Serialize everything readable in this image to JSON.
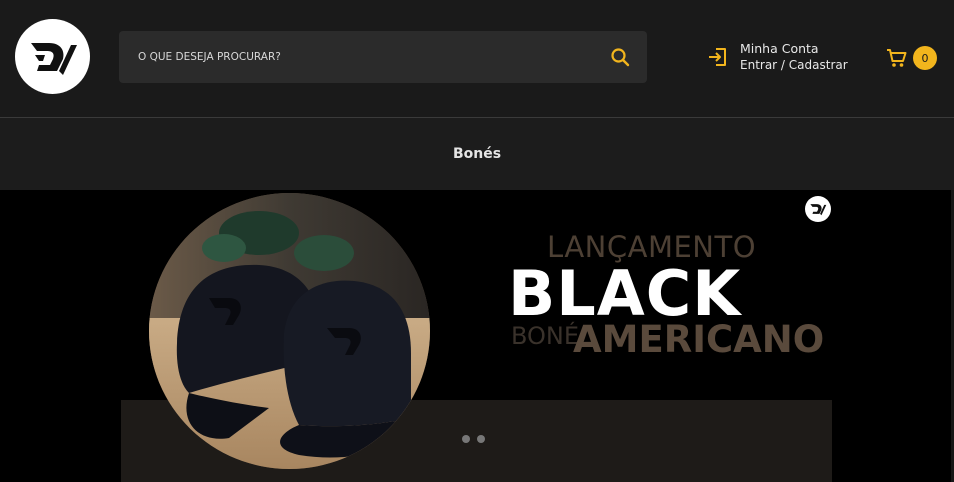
{
  "header": {
    "logo_icon": "dv-monogram-logo",
    "search": {
      "placeholder": "O QUE DESEJA PROCURAR?",
      "value": "",
      "icon": "search-icon"
    },
    "account": {
      "icon": "login-icon",
      "title": "Minha Conta",
      "subtitle": "Entrar / Cadastrar"
    },
    "cart": {
      "icon": "cart-icon",
      "count": "0"
    }
  },
  "nav": {
    "items": [
      {
        "label": "Bonés"
      }
    ]
  },
  "banner": {
    "launch": "LANÇAMENTO",
    "black": "BLACK",
    "bone": "BONÉ",
    "american": "AMERICANO",
    "slides": 2
  },
  "colors": {
    "accent": "#f2b51d",
    "header_bg": "#1a1a1a",
    "search_bg": "#2b2b2b",
    "banner_bg": "#000000",
    "banner_brown": "#5a4a3c"
  }
}
